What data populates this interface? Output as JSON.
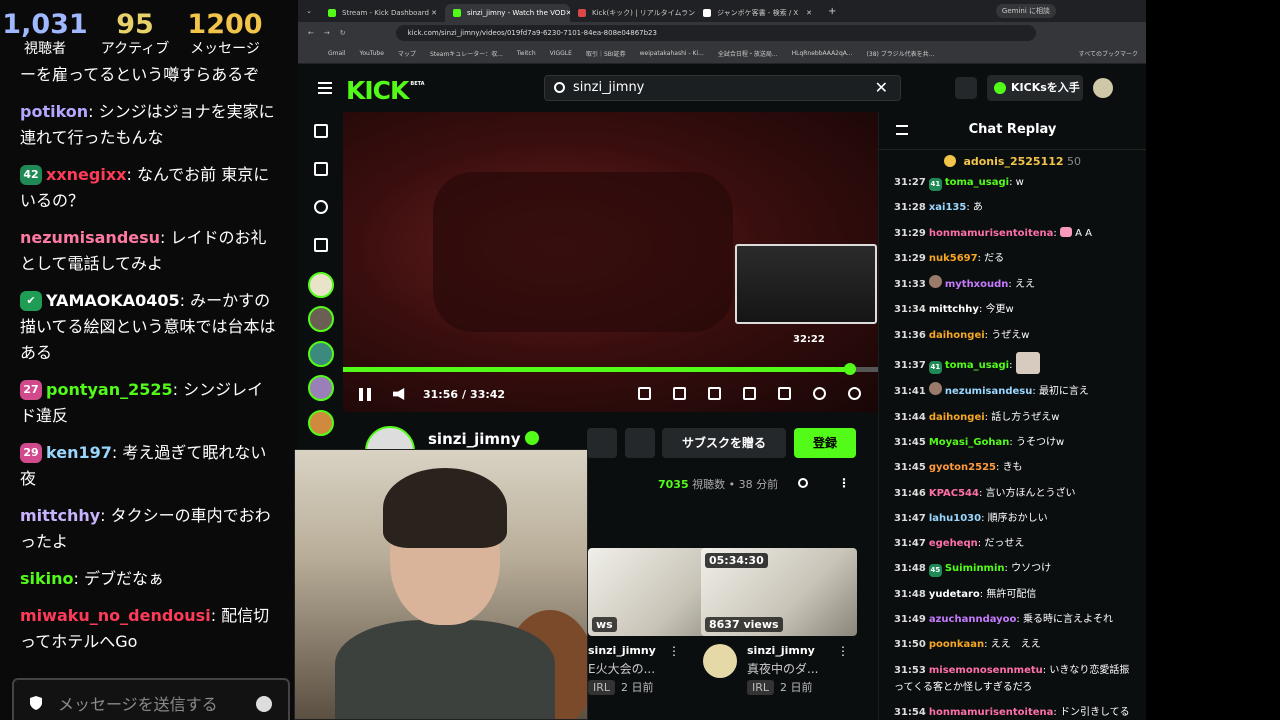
{
  "stream_overlay": {
    "viewers": {
      "num": "1,031",
      "label": "視聴者"
    },
    "active": {
      "num": "95",
      "label": "アクティブ"
    },
    "messages": {
      "num": "1200",
      "label": "メッセージ"
    },
    "messages_list": [
      {
        "user": "",
        "text": "ーを雇ってるという噂すらあるぞ",
        "badge": "",
        "color": "#ffffff"
      },
      {
        "user": "potikon",
        "text": "シンジはジョナを実家に連れて行ったもんな",
        "badge": "",
        "color": "#b7a6ff"
      },
      {
        "user": "xxnegixx",
        "text": "なんでお前 東京にいるの？",
        "badge": "42",
        "color": "#ff3b58"
      },
      {
        "user": "nezumisandesu",
        "text": "レイドのお礼として電話してみよ",
        "badge": "",
        "color": "#ff7aa2"
      },
      {
        "user": "YAMAOKA0405",
        "text": "みーかすの描いてる絵図という意味では台本はある",
        "badge": "✔",
        "color": "#ffffff"
      },
      {
        "user": "pontyan_2525",
        "text": "シンジレイド違反",
        "badge": "27",
        "color": "#53fc18"
      },
      {
        "user": "ken197",
        "text": "考え過ぎて眠れない夜",
        "badge": "29",
        "color": "#9ad7ff"
      },
      {
        "user": "mittchhy",
        "text": "タクシーの車内でおわったよ",
        "badge": "",
        "color": "#c9b3ff"
      },
      {
        "user": "sikino",
        "text": "デブだなぁ",
        "badge": "",
        "color": "#53fc18"
      },
      {
        "user": "miwaku_no_dendousi",
        "text": "配信切ってホテルへGo",
        "badge": "",
        "color": "#ff3b58"
      }
    ],
    "input_placeholder": "メッセージを送信する"
  },
  "browser": {
    "tabs": [
      {
        "title": "Stream - Kick Dashboard",
        "color": "#53fc18"
      },
      {
        "title": "sinzi_jimny - Watch the VOD",
        "color": "#53fc18"
      },
      {
        "title": "Kick(キック) | リアルタイムランキング",
        "color": "#d94848"
      },
      {
        "title": "ジャンボケ客書 - 検索 / X",
        "color": "#ffffff"
      }
    ],
    "active_tab": 1,
    "gemini_label": "Gemini に相談",
    "url": "kick.com/sinzi_jimny/videos/019fd7a9-6230-7101-84ea-808e04867b23",
    "bookmarks": [
      "Gmail",
      "YouTube",
      "マップ",
      "Steamキュレーター：収...",
      "Twitch",
      "VIGGLE",
      "取引｜SBI証券",
      "weipatakahashi - Ki...",
      "全試合日程・放送局...",
      "HLqRnebbAAA2qA...",
      "(38) ブラジル代表を共...",
      "すべてのブックマーク"
    ]
  },
  "kick": {
    "logo": "KICK",
    "logo_sup": "BETA",
    "search_value": "sinzi_jimny",
    "kicks_button": "KICKsを入手",
    "player": {
      "current": "31:56",
      "duration": "33:42",
      "progress_fraction": 0.948,
      "preview_time": "32:22"
    },
    "channel": {
      "name": "sinzi_jimny",
      "gift_label": "サブスクを贈る",
      "subscribe_label": "登録",
      "views_count": "7035",
      "views_label": "視聴数",
      "dot": "•",
      "ago": "38 分前"
    },
    "cards": [
      {
        "duration": "",
        "views": "ws",
        "channel": "sinzi_jimny",
        "title": "E火大会の...",
        "tag": "IRL",
        "ago": "2 日前"
      },
      {
        "duration": "05:34:30",
        "views": "8637 views",
        "channel": "sinzi_jimny",
        "title": "真夜中のダ...",
        "tag": "IRL",
        "ago": "2 日前"
      }
    ]
  },
  "chat_replay": {
    "title": "Chat Replay",
    "pinned": {
      "user": "adonis_2525112",
      "value": "50"
    },
    "rows": [
      {
        "time": "31:27",
        "badge": "41",
        "user": "toma_usagi",
        "color": "#53fc18",
        "text": "w"
      },
      {
        "time": "31:28",
        "badge": "",
        "user": "xai135",
        "color": "#9ad7ff",
        "text": "あ"
      },
      {
        "time": "31:29",
        "badge": "",
        "user": "honmamurisentoitena",
        "color": "#ff6fa8",
        "text": "emote A A"
      },
      {
        "time": "31:29",
        "badge": "",
        "user": "nuk5697",
        "color": "#f5a623",
        "text": "だる"
      },
      {
        "time": "31:33",
        "badge": "av",
        "user": "mythxoudn",
        "color": "#c67bff",
        "text": "ええ"
      },
      {
        "time": "31:34",
        "badge": "",
        "user": "mittchhy",
        "color": "#ffffff",
        "text": "今更w"
      },
      {
        "time": "31:36",
        "badge": "",
        "user": "daihongei",
        "color": "#f5a623",
        "text": "うぜえw"
      },
      {
        "time": "31:37",
        "badge": "41",
        "user": "toma_usagi",
        "color": "#53fc18",
        "text": "img"
      },
      {
        "time": "31:41",
        "badge": "av",
        "user": "nezumisandesu",
        "color": "#9ad7ff",
        "text": "最初に言え"
      },
      {
        "time": "31:44",
        "badge": "",
        "user": "daihongei",
        "color": "#f5a623",
        "text": "話し方うぜえw"
      },
      {
        "time": "31:45",
        "badge": "",
        "user": "Moyasi_Gohan",
        "color": "#53fc18",
        "text": "うそつけw"
      },
      {
        "time": "31:45",
        "badge": "",
        "user": "gyoton2525",
        "color": "#ff9a3c",
        "text": "きも"
      },
      {
        "time": "31:46",
        "badge": "",
        "user": "KPAC544",
        "color": "#ff6fa8",
        "text": "言い方ほんとうざい"
      },
      {
        "time": "31:47",
        "badge": "",
        "user": "lahu1030",
        "color": "#9ad7ff",
        "text": "順序おかしい"
      },
      {
        "time": "31:47",
        "badge": "",
        "user": "egeheqn",
        "color": "#ff6fa8",
        "text": "だっせえ"
      },
      {
        "time": "31:48",
        "badge": "45",
        "user": "Suiminmin",
        "color": "#53fc18",
        "text": "ウソつけ"
      },
      {
        "time": "31:48",
        "badge": "",
        "user": "yudetaro",
        "color": "#ffffff",
        "text": "無許可配信"
      },
      {
        "time": "31:49",
        "badge": "",
        "user": "azuchanndayoo",
        "color": "#c67bff",
        "text": "乗る時に言えよそれ"
      },
      {
        "time": "31:50",
        "badge": "",
        "user": "poonkaan",
        "color": "#f5a623",
        "text": "ええ　ええ"
      },
      {
        "time": "31:53",
        "badge": "",
        "user": "misemonosennmetu",
        "color": "#ff6fa8",
        "text": "いきなり恋愛話振ってくる客とか怪しすぎるだろ"
      },
      {
        "time": "31:54",
        "badge": "",
        "user": "honmamurisentoitena",
        "color": "#ff6fa8",
        "text": "ドン引きしてる"
      }
    ]
  }
}
